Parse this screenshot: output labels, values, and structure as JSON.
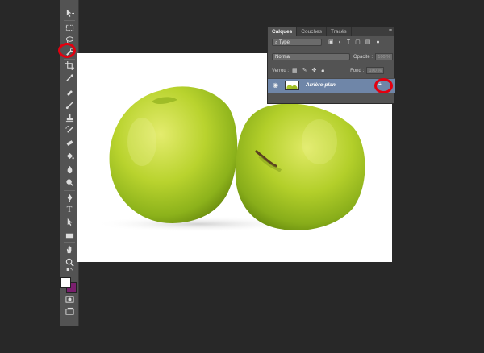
{
  "layers_panel": {
    "tabs": [
      "Calques",
      "Couches",
      "Tracés"
    ],
    "filter": "⌕ Type",
    "blend_mode": "Normal",
    "opacity_label": "Opacité :",
    "opacity_value": "100 %",
    "lock_label": "Verrou :",
    "fill_label": "Fond :",
    "fill_value": "100 %",
    "layer_name": "Arrière-plan"
  },
  "tools": [
    "move-tool",
    "marquee-tool",
    "lasso-tool",
    "quick-selection-tool",
    "crop-tool",
    "eyedropper-tool",
    "spot-healing-tool",
    "brush-tool",
    "clone-stamp-tool",
    "history-brush-tool",
    "eraser-tool",
    "paint-bucket-tool",
    "blur-tool",
    "dodge-tool",
    "pen-tool",
    "type-tool",
    "path-selection-tool",
    "rectangle-tool",
    "hand-tool",
    "zoom-tool"
  ],
  "colors": {
    "foreground": "#ffffff",
    "background": "#7a1f6e",
    "highlight": "#e3000f",
    "layer_selected": "#6f86a8"
  }
}
